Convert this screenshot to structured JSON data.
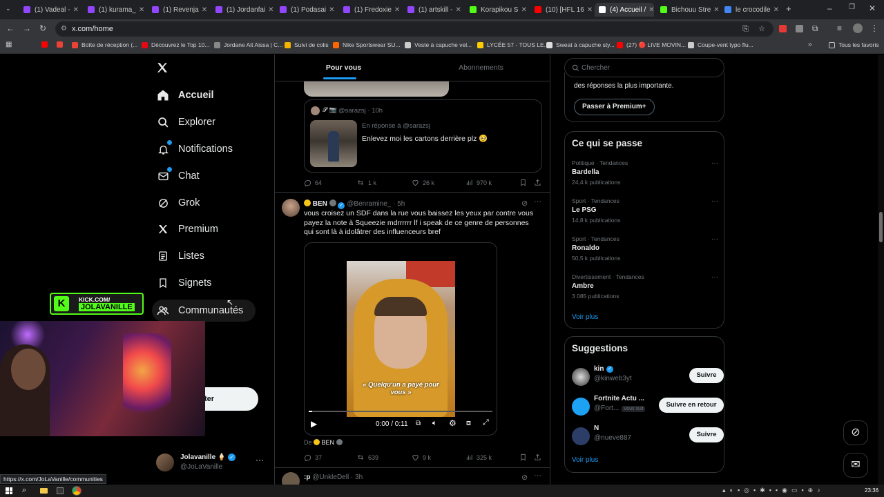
{
  "browser": {
    "tabs": [
      {
        "title": "(1) Vadeal -",
        "color": "#9146ff"
      },
      {
        "title": "(1) kurama_",
        "color": "#9146ff"
      },
      {
        "title": "(1) Revenja",
        "color": "#9146ff"
      },
      {
        "title": "(1) Jordanfai",
        "color": "#9146ff"
      },
      {
        "title": "(1) Podasai",
        "color": "#9146ff"
      },
      {
        "title": "(1) Fredoxie",
        "color": "#9146ff"
      },
      {
        "title": "(1) artskill -",
        "color": "#9146ff"
      },
      {
        "title": "Korapikou S",
        "color": "#53fc18"
      },
      {
        "title": "(10) [HFL 16",
        "color": "#ff0000"
      },
      {
        "title": "(4) Accueil /",
        "color": "#ffffff"
      },
      {
        "title": "Bichouu Stre",
        "color": "#53fc18"
      },
      {
        "title": "le crocodile",
        "color": "#4285f4"
      }
    ],
    "url": "x.com/home",
    "bookmarks": [
      {
        "label": "",
        "color": "#ff0000"
      },
      {
        "label": "",
        "color": "#ea4335"
      },
      {
        "label": "Boîte de réception (...",
        "color": "#ea4335"
      },
      {
        "label": "Découvrez le Top 10...",
        "color": "#e50914"
      },
      {
        "label": "Jordane Ait Aissa | C...",
        "color": "#888888"
      },
      {
        "label": "Suivi de colis",
        "color": "#f4b400"
      },
      {
        "label": "Nike Sportswear SU...",
        "color": "#ff6600"
      },
      {
        "label": "Veste à capuche vel...",
        "color": "#cccccc"
      },
      {
        "label": "LYCÉE 57 - TOUS LE...",
        "color": "#ffcc00"
      },
      {
        "label": "Sweat à capuche sty...",
        "color": "#dddddd"
      },
      {
        "label": "(27) 🔴 LIVE MOVIN...",
        "color": "#ff0000"
      },
      {
        "label": "Coupe-vent typo flu...",
        "color": "#cccccc"
      }
    ],
    "all_bookmarks": "Tous les favoris",
    "status_url": "https://x.com/JoLaVanille/communities",
    "clock": "23:36"
  },
  "nav": {
    "items": [
      {
        "label": "Accueil",
        "icon": "home-icon",
        "bold": true
      },
      {
        "label": "Explorer",
        "icon": "search-icon"
      },
      {
        "label": "Notifications",
        "icon": "bell-icon",
        "badge": true
      },
      {
        "label": "Chat",
        "icon": "mail-icon",
        "badge": true
      },
      {
        "label": "Grok",
        "icon": "grok-icon"
      },
      {
        "label": "Premium",
        "icon": "x-logo-icon"
      },
      {
        "label": "Listes",
        "icon": "list-icon"
      },
      {
        "label": "Signets",
        "icon": "bookmark-icon"
      },
      {
        "label": "Communautés",
        "icon": "communities-icon"
      }
    ],
    "post_button": "ter",
    "profile": {
      "name": "Jolavanille 🍦",
      "handle": "@JoLaVanille"
    }
  },
  "overlay": {
    "kick_line1": "KICK.COM/",
    "kick_line2": "JOLAVANILLE"
  },
  "feed": {
    "tabs": [
      "Pour vous",
      "Abonnements"
    ],
    "quoted": {
      "handle": "@sarazsj",
      "time": "10h",
      "reply_label": "En réponse à @sarazsj",
      "text": "Enlevez moi les cartons derrière plz 🥺"
    },
    "post1_actions": {
      "replies": "64",
      "reposts": "1 k",
      "likes": "26 k",
      "views": "970 k"
    },
    "post2": {
      "name": "BEN",
      "handle": "@Benramine_",
      "time": "5h",
      "text": "vous croisez un SDF dans la rue vous baissez les yeux par contre vous payez la note à Squeezie mdrrrrrr lf i speak de ce genre de personnes qui sont là à idolâtrer des influenceurs bref",
      "video_caption": "« Quelqu'un a payé pour vous »",
      "video_time": "0:00 / 0:11",
      "video_progress": 0.02,
      "from_label": "De",
      "from_name": "BEN",
      "actions": {
        "replies": "37",
        "reposts": "639",
        "likes": "9 k",
        "views": "325 k"
      }
    },
    "post3": {
      "name": ":p",
      "handle": "@UnkleDell",
      "time": "3h"
    }
  },
  "sidebar": {
    "search_placeholder": "Chercher",
    "premium_text": "des réponses la plus importante.",
    "premium_button": "Passer à Premium+",
    "trends_title": "Ce qui se passe",
    "trends": [
      {
        "category": "Politique · Tendances",
        "name": "Bardella",
        "count": "24,4 k publications"
      },
      {
        "category": "Sport · Tendances",
        "name": "Le PSG",
        "count": "14,8 k publications"
      },
      {
        "category": "Sport · Tendances",
        "name": "Ronaldo",
        "count": "50,5 k publications"
      },
      {
        "category": "Divertissement · Tendances",
        "name": "Ambre",
        "count": "3 085 publications"
      }
    ],
    "see_more": "Voir plus",
    "suggestions_title": "Suggestions",
    "suggestions": [
      {
        "name": "kin",
        "handle": "@kinweb3yt",
        "verified": true,
        "button": "Suivre",
        "follows_you": ""
      },
      {
        "name": "Fortnite Actu ...",
        "handle": "@Fort...",
        "verified": false,
        "button": "Suivre en retour",
        "follows_you": "Vous suit"
      },
      {
        "name": "N",
        "handle": "@nueve887",
        "verified": false,
        "button": "Suivre",
        "follows_you": ""
      }
    ],
    "see_more_2": "Voir plus"
  },
  "colors": {
    "accent": "#1d9bf0",
    "border": "#2f3336",
    "kick": "#53fc18"
  }
}
